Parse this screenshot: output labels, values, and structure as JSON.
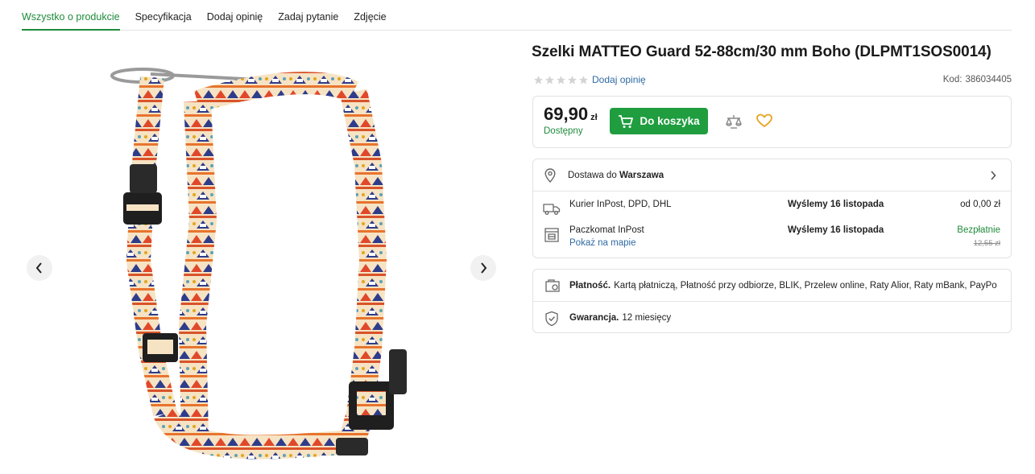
{
  "tabs": [
    {
      "label": "Wszystko o produkcie",
      "active": true
    },
    {
      "label": "Specyfikacja",
      "active": false
    },
    {
      "label": "Dodaj opinię",
      "active": false
    },
    {
      "label": "Zadaj pytanie",
      "active": false
    },
    {
      "label": "Zdjęcie",
      "active": false
    }
  ],
  "gallery": {
    "prev_icon": "chevron-left-icon",
    "next_icon": "chevron-right-icon",
    "image_subject": "patterned dog harness"
  },
  "product": {
    "title": "Szelki MATTEO Guard 52-88cm/30 mm Boho (DLPMT1SOS0014)",
    "rating_stars": 0,
    "add_review": "Dodaj opinię",
    "code_label": "Kod:",
    "code_value": "386034405"
  },
  "buybox": {
    "price": "69,90",
    "currency": "zł",
    "availability": "Dostępny",
    "cart_button": "Do koszyka",
    "accent": "#1f9d3f"
  },
  "delivery": {
    "label": "Dostawa do",
    "city": "Warszawa",
    "methods": [
      {
        "name": "Kurier InPost, DPD, DHL",
        "ship": "Wyślemy 16 listopada",
        "cost": "od 0,00 zł",
        "link": "",
        "old_price": ""
      },
      {
        "name": "Paczkomat InPost",
        "ship": "Wyślemy 16 listopada",
        "cost": "Bezpłatnie",
        "link": "Pokaż na mapie",
        "old_price": "12,55 zł"
      }
    ]
  },
  "info": {
    "payment_label": "Płatność.",
    "payment_text": "Kartą płatniczą, Płatność przy odbiorze, BLIK, Przelew online, Raty Alior, Raty mBank, PayPo",
    "warranty_label": "Gwarancja.",
    "warranty_text": "12 miesięcy"
  }
}
